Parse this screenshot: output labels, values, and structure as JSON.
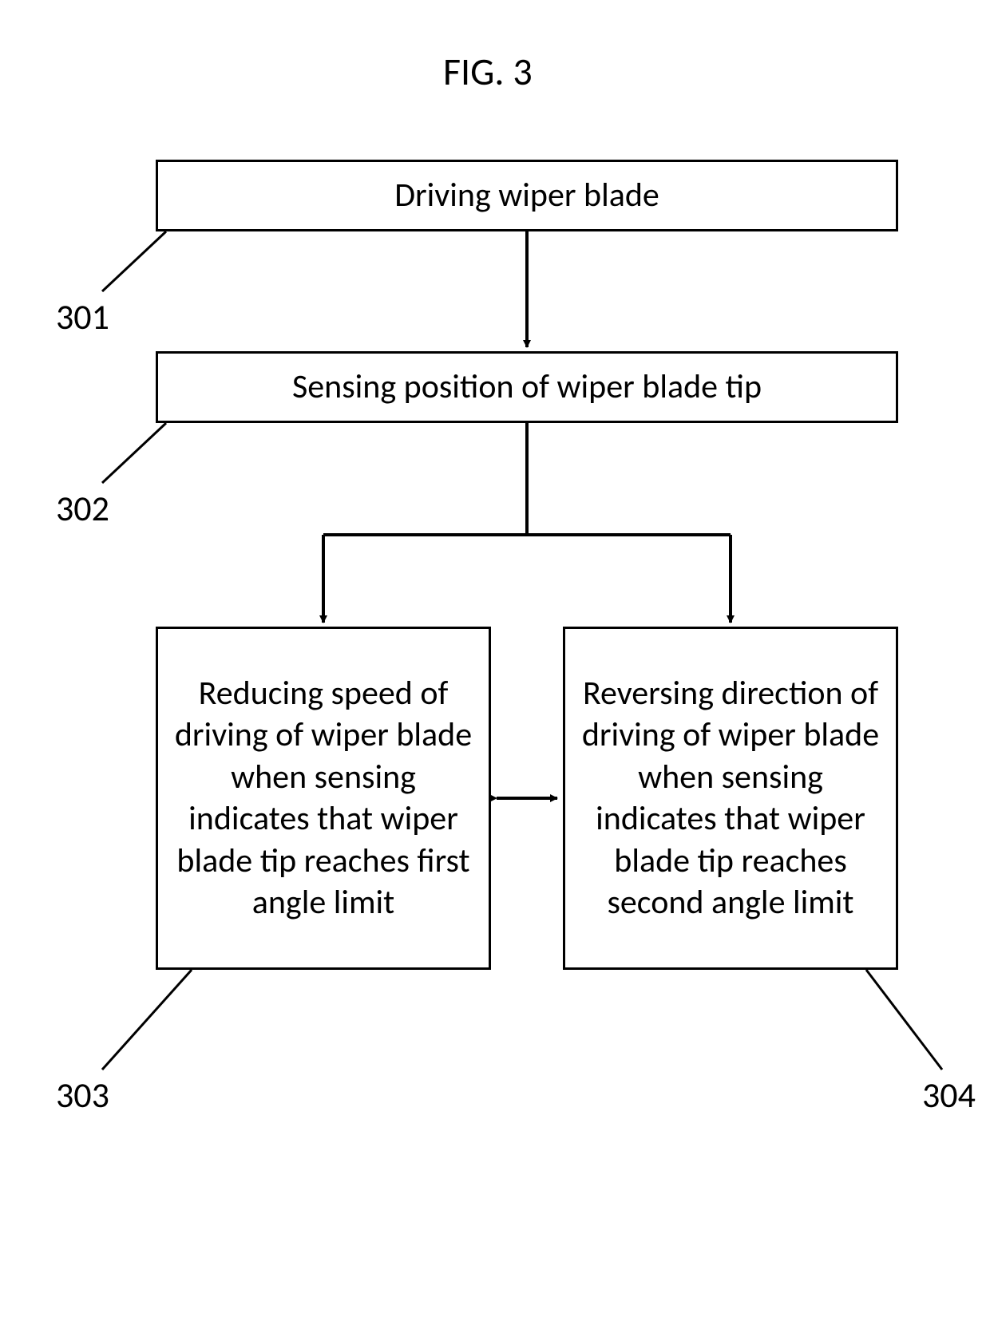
{
  "figure_title": "FIG. 3",
  "boxes": {
    "b301": {
      "ref": "301",
      "text": "Driving wiper blade"
    },
    "b302": {
      "ref": "302",
      "text": "Sensing position of wiper blade tip"
    },
    "b303": {
      "ref": "303",
      "text": "Reducing speed of driving of wiper blade when sensing indicates that wiper blade tip reaches first angle limit"
    },
    "b304": {
      "ref": "304",
      "text": "Reversing direction of driving of wiper blade when sensing indicates that wiper blade tip reaches second angle limit"
    }
  }
}
